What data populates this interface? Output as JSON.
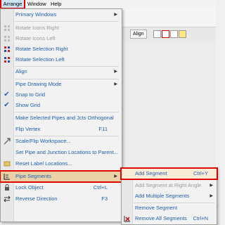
{
  "menubar": {
    "arrange": "Arrange",
    "window": "Window",
    "help": "Help"
  },
  "toolbar": {
    "align_label": "Align"
  },
  "menu": {
    "primary_windows": "Primary Windows",
    "rotate_icons_right": "Rotate Icons Right",
    "rotate_icons_left": "Rotate Icons Left",
    "rotate_selection_right": "Rotate Selection Right",
    "rotate_selection_left": "Rotate Selection Left",
    "align": "Align",
    "pipe_drawing_mode": "Pipe Drawing Mode",
    "snap_to_grid": "Snap to Grid",
    "show_grid": "Show Grid",
    "make_orthogonal": "Make Selected Pipes and Jcts Orthogonal",
    "flip_vertex": "Flip Vertex",
    "flip_vertex_shortcut": "F11",
    "scale_flip_workspace": "Scale/Flip Workspace...",
    "set_pipe_locations": "Set Pipe and Junction Locations to Parent...",
    "reset_label_locations": "Reset Label Locations...",
    "pipe_segments": "Pipe Segments",
    "lock_object": "Lock Object",
    "lock_object_shortcut": "Ctrl+L",
    "reverse_direction": "Reverse Direction",
    "reverse_direction_shortcut": "F3"
  },
  "submenu": {
    "add_segment": "Add Segment",
    "add_segment_shortcut": "Ctrl+Y",
    "add_segment_right_angle": "Add Segment at Right Angle",
    "add_multiple_segments": "Add Multiple Segments",
    "remove_segment": "Remove Segment",
    "remove_all_segments": "Remove All Segments",
    "remove_all_segments_shortcut": "Ctrl+N"
  },
  "colors": {
    "highlight_outline": "#e00000",
    "menu_text": "#1f5fb5",
    "disabled_text": "#9a9a9a"
  }
}
